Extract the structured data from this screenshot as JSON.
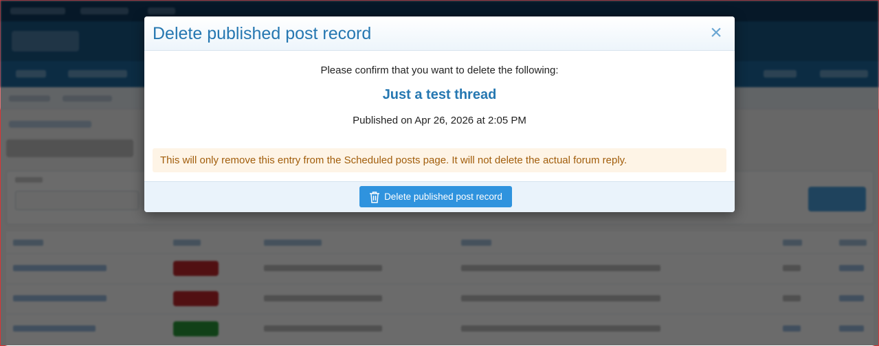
{
  "modal": {
    "title": "Delete published post record",
    "close_symbol": "×",
    "confirm_text": "Please confirm that you want to delete the following:",
    "thread_title": "Just a test thread",
    "published_text": "Published on Apr 26, 2026 at 2:05 PM",
    "notice": "This will only remove this entry from the Scheduled posts page. It will not delete the actual forum reply.",
    "delete_button_label": "Delete published post record",
    "delete_button_icon": "trash-icon"
  },
  "colors": {
    "accent": "#2577b1",
    "button": "#2f93de",
    "notice_bg": "#fef4e6",
    "notice_text": "#a15d0b",
    "status_red": "#c0282d",
    "status_green": "#2a9a3a"
  }
}
